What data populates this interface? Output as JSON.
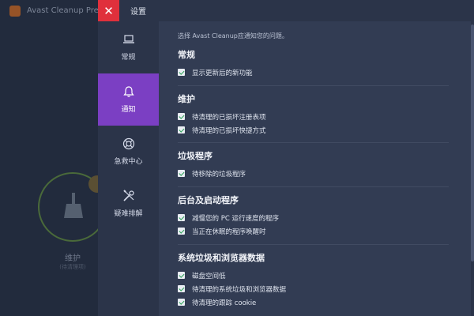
{
  "background": {
    "app_title": "Avast Cleanup Premium",
    "action_label": "维护",
    "action_sublabel": "(待清理项)"
  },
  "topbar": {
    "close_glyph": "✕",
    "title": "设置"
  },
  "sidebar": {
    "items": [
      {
        "label": "常规",
        "icon": "laptop-icon",
        "active": false
      },
      {
        "label": "通知",
        "icon": "bell-icon",
        "active": true
      },
      {
        "label": "急救中心",
        "icon": "lifebuoy-icon",
        "active": false
      },
      {
        "label": "疑难排解",
        "icon": "tools-icon",
        "active": false
      }
    ]
  },
  "content": {
    "intro": "选择 Avast Cleanup应通知您的问题。",
    "sections": [
      {
        "title": "常规",
        "options": [
          "显示更新后的新功能"
        ]
      },
      {
        "title": "维护",
        "options": [
          "待清理的已损坏注册表项",
          "待清理的已损坏快捷方式"
        ]
      },
      {
        "title": "垃圾程序",
        "options": [
          "待移除的垃圾程序"
        ]
      },
      {
        "title": "后台及启动程序",
        "options": [
          "减慢您的 PC 运行速度的程序",
          "当正在休眠的程序唤醒时"
        ]
      },
      {
        "title": "系统垃圾和浏览器数据",
        "options": [
          "磁盘空间低",
          "待清理的系统垃圾和浏览器数据",
          "待清理的跟踪 cookie"
        ]
      }
    ]
  },
  "colors": {
    "accent": "#7b3fc3",
    "close": "#e0303c",
    "check": "#2fa35a"
  }
}
